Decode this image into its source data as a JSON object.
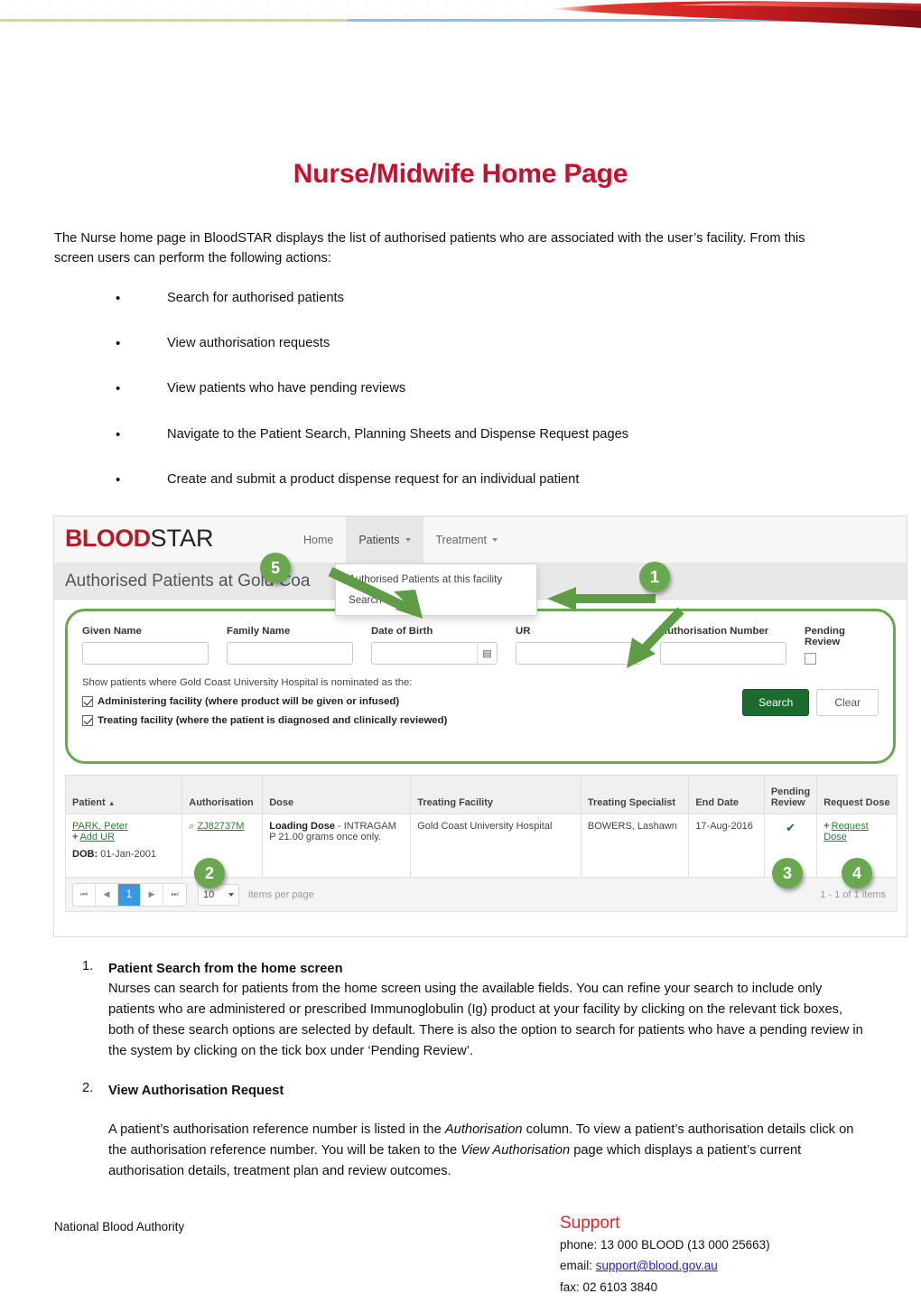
{
  "document": {
    "title": "Nurse/Midwife Home Page",
    "intro": "The Nurse home page in BloodSTAR displays the list of authorised patients who are associated with the user’s facility. From this screen users can perform the following actions:",
    "bullets": [
      "Search for authorised patients",
      "View authorisation requests",
      "View patients who have pending reviews",
      "Navigate to the Patient Search, Planning Sheets and Dispense Request pages",
      "Create and submit a product dispense request for an individual patient"
    ],
    "steps": [
      {
        "number": "1.",
        "heading": "Patient Search from the home screen",
        "body": "Nurses can search for patients from the home screen using the available fields. You can refine your search to include only patients who are administered or prescribed Immunoglobulin (Ig) product at your facility by clicking on the relevant tick boxes, both of these search options are selected by default. There is also the option to search for patients who have a pending review in the system by clicking on the tick box under ‘Pending Review’."
      },
      {
        "number": "2.",
        "heading": "View Authorisation Request",
        "body_1": "A patient’s authorisation reference number is listed in the ",
        "body_em1": "Authorisation",
        "body_2": " column. To view a patient’s authorisation details click on the authorisation reference number. You will be taken to the ",
        "body_em2": "View Authorisation",
        "body_3": " page which displays a patient’s current authorisation details, treatment plan and review outcomes."
      }
    ]
  },
  "screenshot": {
    "brand": {
      "part1": "BLOOD",
      "part2": "STAR"
    },
    "nav": [
      {
        "label": "Home",
        "has_caret": false
      },
      {
        "label": "Patients",
        "has_caret": true
      },
      {
        "label": "Treatment",
        "has_caret": true
      }
    ],
    "dropdown": {
      "items": [
        "Authorised Patients at this facility",
        "Search"
      ]
    },
    "page_title": "Authorised Patients at Gold Coa",
    "search_panel": {
      "fields": [
        {
          "label": "Given Name",
          "value": ""
        },
        {
          "label": "Family Name",
          "value": ""
        },
        {
          "label": "Date of Birth",
          "value": ""
        },
        {
          "label": "UR",
          "value": ""
        },
        {
          "label": "Authorisation Number",
          "value": ""
        },
        {
          "label": "Pending Review",
          "value": ""
        }
      ],
      "calendar_icon": "▤",
      "show_line": "Show patients where Gold Coast University Hospital is nominated as the:",
      "options": [
        {
          "label": "Administering facility (where product will be given or infused)",
          "checked": true
        },
        {
          "label": "Treating facility (where the patient is diagnosed and clinically reviewed)",
          "checked": true
        }
      ],
      "search_button": "Search",
      "clear_button": "Clear"
    },
    "table": {
      "columns": [
        "Patient",
        "Authorisation",
        "Dose",
        "Treating Facility",
        "Treating Specialist",
        "End Date",
        "Pending Review",
        "Request Dose"
      ],
      "sort_indicator": "▲",
      "rows": [
        {
          "patient_name": "PARK, Peter",
          "add_ur": "Add UR",
          "dob_label": "DOB:",
          "dob_value": "01-Jan-2001",
          "authorisation": "ZJ82737M",
          "magnifier": "⌕",
          "dose_bold": "Loading Dose",
          "dose_rest": " - INTRAGAM P 21.00 grams once only.",
          "treating_facility": "Gold Coast University Hospital",
          "treating_specialist": "BOWERS, Lashawn",
          "end_date": "17-Aug-2016",
          "pending_review": "✔",
          "request_dose": "Request Dose"
        }
      ]
    },
    "pager": {
      "first": "⏮",
      "prev": "◀",
      "page": "1",
      "next": "▶",
      "last": "⏭",
      "page_size": "10",
      "items_per_page": "items per page",
      "count": "1 - 1 of 1 items"
    },
    "annotations": [
      {
        "id": "1",
        "label": "1"
      },
      {
        "id": "2",
        "label": "2"
      },
      {
        "id": "3",
        "label": "3"
      },
      {
        "id": "4",
        "label": "4"
      },
      {
        "id": "5",
        "label": "5"
      }
    ]
  },
  "footer": {
    "organisation": "National Blood Authority",
    "support_title": "Support",
    "phone": "phone: 13 000 BLOOD (13 000 25663)",
    "email_prefix": "email: ",
    "email": "support@blood.gov.au",
    "fax": "fax: 02 6103 3840"
  },
  "colors": {
    "title_red": "#c8102e",
    "brand_red": "#b01e28",
    "annotation_green": "#6aa84f",
    "button_green": "#1b6b2f",
    "link_green": "#2e7d32",
    "pager_blue": "#3c97dd",
    "support_red": "#e8232a",
    "rule_green": "#c5de8e",
    "rule_blue": "#77c8ef"
  }
}
